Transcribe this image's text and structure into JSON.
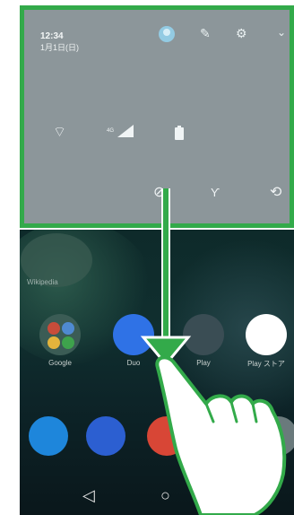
{
  "shade": {
    "time": "12:34",
    "date": "1月1日(日)",
    "header_icons": [
      "user-icon",
      "pencil-icon",
      "gear-icon",
      "chevron-down-icon"
    ],
    "tiles": [
      "wifi-off-icon",
      "signal-4g-icon",
      "battery-icon",
      "do-not-disturb-icon",
      "flashlight-icon",
      "auto-rotate-icon"
    ],
    "signal_label": "4G"
  },
  "home": {
    "widget_label": "Wikipedia",
    "apps": [
      {
        "label": "Google"
      },
      {
        "label": "Duo"
      },
      {
        "label": "Play"
      },
      {
        "label": "Play ストア"
      }
    ],
    "dock": [
      "phone-icon",
      "messages-icon",
      "gmail-icon",
      "chrome-icon",
      "photos-icon"
    ]
  },
  "overlay": {
    "arrow_color": "#33aa4a",
    "hand_color": "#ffffff"
  }
}
